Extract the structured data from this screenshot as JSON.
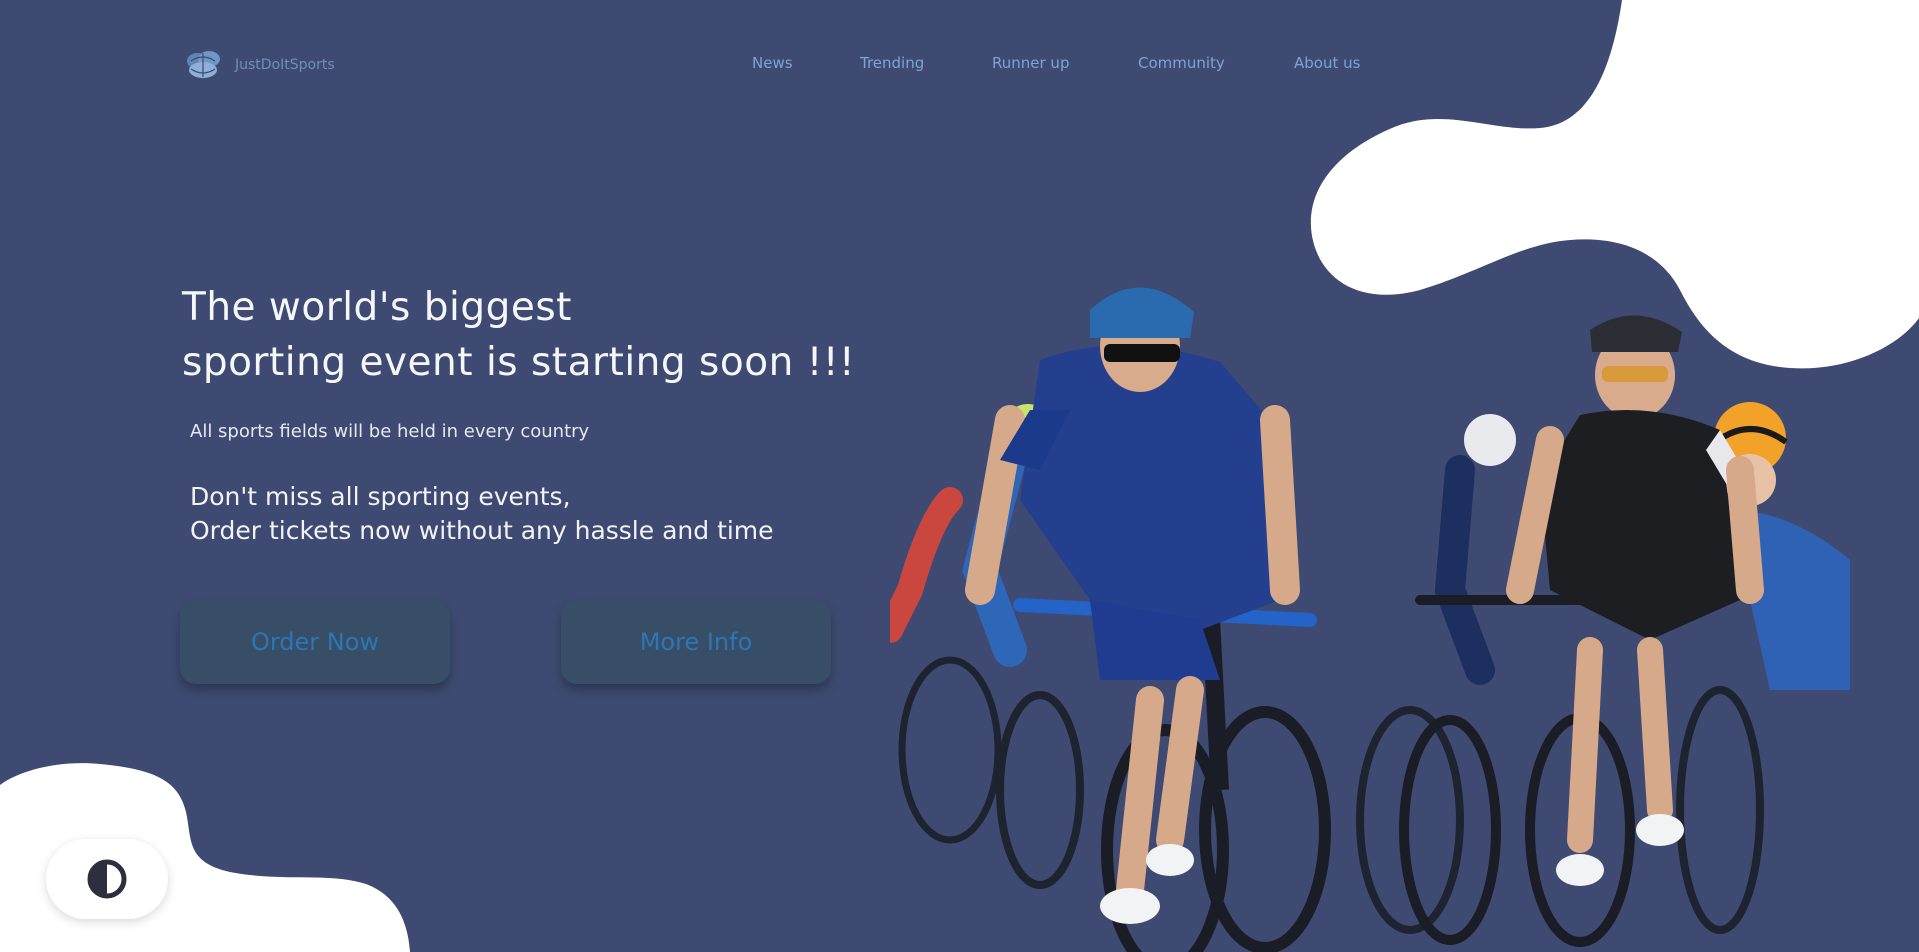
{
  "brand": {
    "name": "JustDoItSports",
    "logo_icon": "globe-logo-icon"
  },
  "nav": {
    "items": [
      {
        "label": "News"
      },
      {
        "label": "Trending"
      },
      {
        "label": "Runner up"
      },
      {
        "label": "Community"
      },
      {
        "label": "About us"
      }
    ]
  },
  "hero": {
    "title_line1": "The world's biggest",
    "title_line2": "sporting event is starting soon !!!",
    "subtitle": "All sports fields will be held in every country",
    "desc_line1": "Don't miss all sporting events,",
    "desc_line2": "Order tickets now without any hassle and time",
    "image_icon": "cyclists-photo"
  },
  "buttons": {
    "order_label": "Order Now",
    "more_label": "More Info"
  },
  "theme_toggle": {
    "icon": "contrast-icon"
  },
  "colors": {
    "background": "#3e4a71",
    "blob": "#ffffff",
    "nav_text": "#7ea3d4",
    "button_bg": "#374e66",
    "button_text": "#2b76b6"
  }
}
